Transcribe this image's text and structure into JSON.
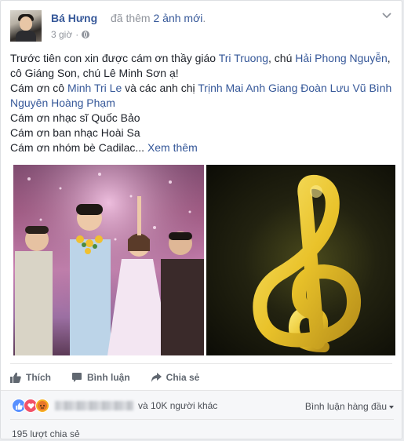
{
  "post": {
    "author": "Bá Hưng",
    "action_prefix": "đã thêm",
    "action_link": "2 ảnh mới",
    "action_suffix": ".",
    "time": "3 giờ",
    "separator": "·"
  },
  "content": {
    "line1_a": "Trước tiên con xin được cám ơn thầy giáo ",
    "link_tri_truong": "Tri Truong",
    "line1_b": ", chú ",
    "link_hai_phong": "Hải Phong Nguyễn",
    "line1_c": ", cô Giáng Son, chú Lê Minh Sơn ạ!",
    "line2_a": "Cám ơn cô ",
    "link_minh_tri": "Minh Tri Le",
    "line2_b": " và các anh chị ",
    "link_trinh_mai": "Trịnh Mai Anh Giang Đoàn Lưu Vũ Bình Nguyên Hoàng Phạm",
    "line3": "Cám ơn nhạc sĩ Quốc Bảo",
    "line4": "Cám ơn ban nhạc Hoài Sa",
    "line5": "Cám ơn nhóm bè Cadilac...",
    "see_more": "Xem thêm"
  },
  "actions": {
    "like": "Thích",
    "comment": "Bình luận",
    "share": "Chia sẻ"
  },
  "reactions": {
    "others": "và 10K người khác",
    "sort": "Bình luận hàng đầu",
    "shares": "195 lượt chia sẻ"
  },
  "icons": [
    "globe-icon",
    "chevron-down-icon",
    "like-icon",
    "comment-icon",
    "share-icon",
    "like-reaction-icon",
    "love-reaction-icon",
    "angry-reaction-icon"
  ],
  "colors": {
    "link": "#365899",
    "meta": "#90949c",
    "like_blue": "#5890ff",
    "love_red": "#f25268",
    "angry_yellow": "#f7b125"
  }
}
